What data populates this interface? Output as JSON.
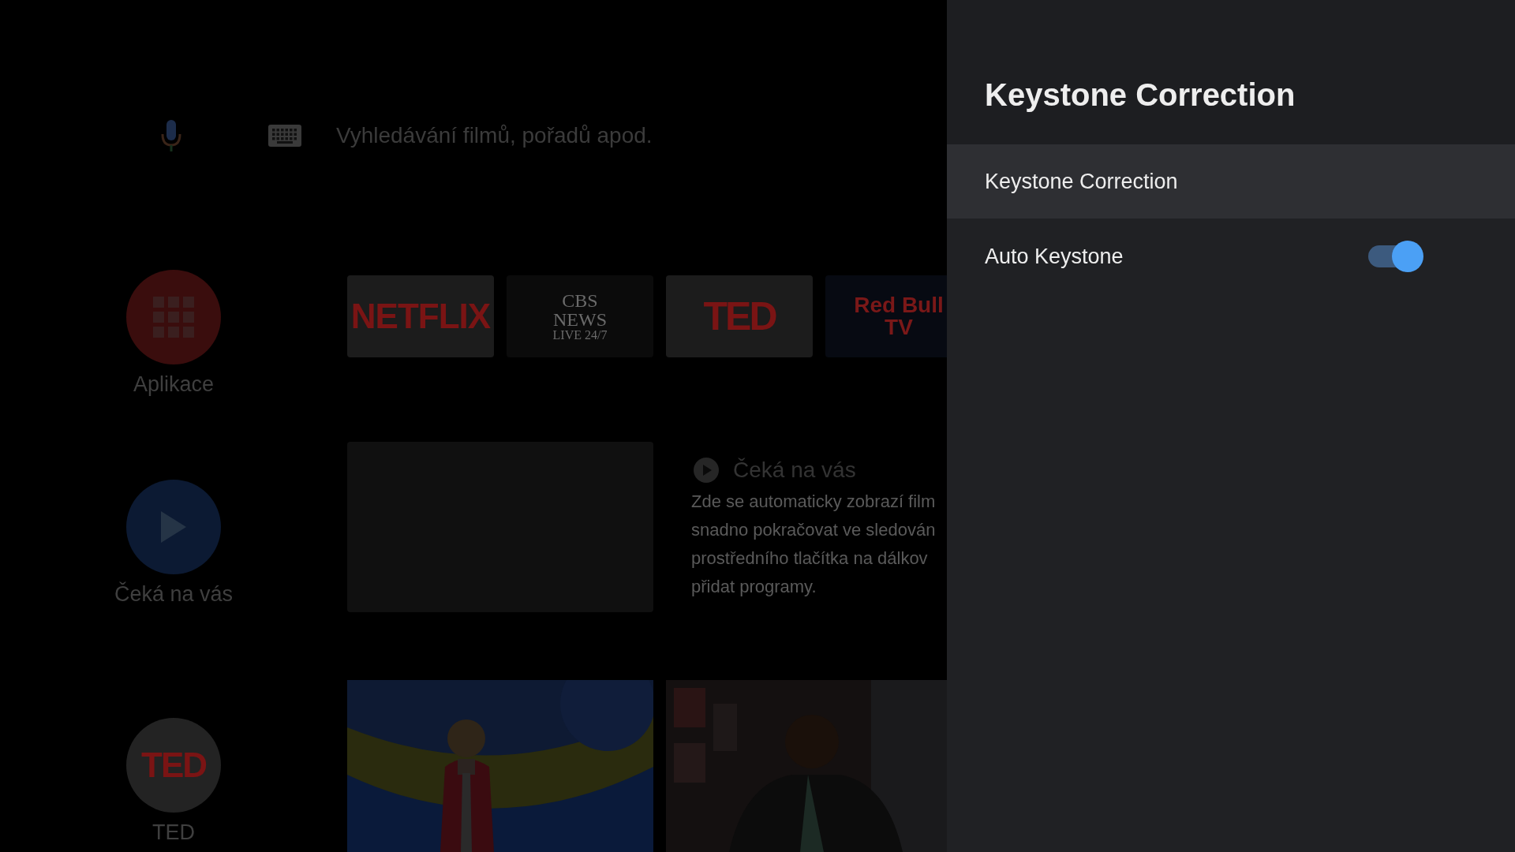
{
  "search": {
    "placeholder": "Vyhledávání filmů, pořadů apod."
  },
  "sidebar": [
    {
      "kind": "grid",
      "label": "Aplikace",
      "color": "#3a0d0d"
    },
    {
      "kind": "play",
      "label": "Čeká na vás",
      "color": "#0c1a33"
    },
    {
      "kind": "logo",
      "logo_text": "TED",
      "label": "TED",
      "color": "#232323"
    }
  ],
  "app_tiles": [
    {
      "kind": "netflix",
      "lines": [
        "NETFLIX"
      ]
    },
    {
      "kind": "cbs",
      "lines": [
        "CBS",
        "NEWS",
        "LIVE 24/7"
      ]
    },
    {
      "kind": "ted",
      "lines": [
        "TED"
      ]
    },
    {
      "kind": "redbull",
      "lines": [
        "Red Bull",
        "TV"
      ]
    }
  ],
  "watch_next": {
    "title": "Čeká na vás",
    "lines": [
      "Zde se automaticky zobrazí film",
      "snadno pokračovat ve sledován",
      "prostředního tlačítka na dálkov",
      "přidat programy."
    ]
  },
  "panel": {
    "title": "Keystone Correction",
    "rows": [
      {
        "kind": "plain",
        "label": "Keystone Correction",
        "selected": true
      },
      {
        "kind": "toggle",
        "label": "Auto Keystone",
        "on": true,
        "selected": false
      }
    ]
  }
}
